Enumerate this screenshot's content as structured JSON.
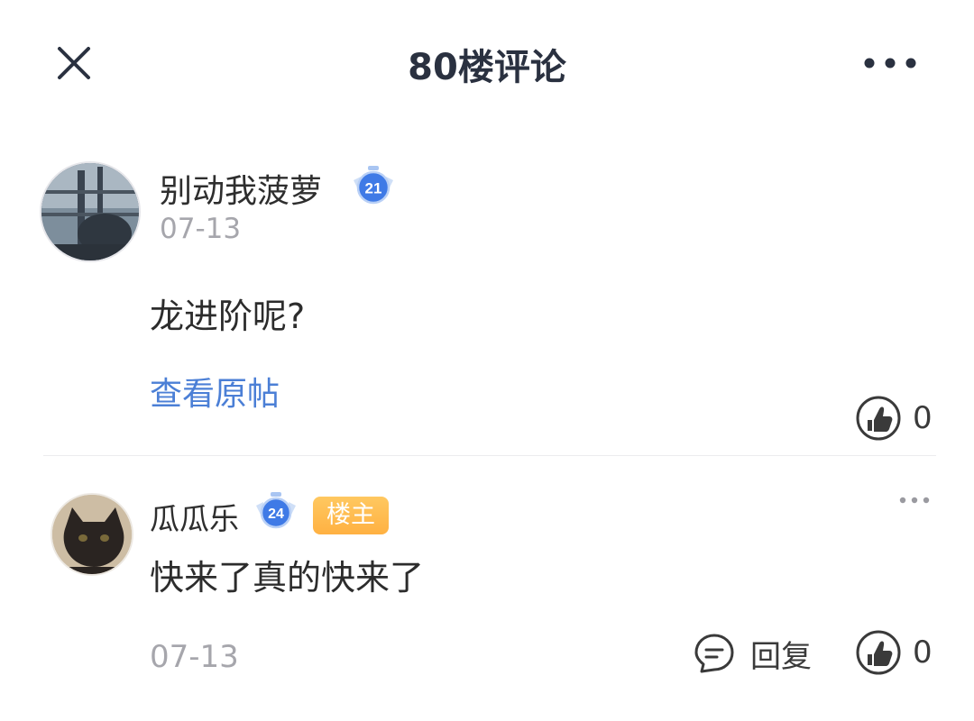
{
  "header": {
    "title": "80楼评论",
    "close_icon": "close-icon",
    "more_icon": "more-horizontal-icon"
  },
  "main_comment": {
    "username": "别动我菠萝",
    "level": "21",
    "timestamp": "07-13",
    "content": "龙进阶呢?",
    "view_original_label": "查看原帖",
    "like_count": "0"
  },
  "replies": [
    {
      "username": "瓜瓜乐",
      "level": "24",
      "op_badge": "楼主",
      "content": "快来了真的快来了",
      "timestamp": "07-13",
      "reply_label": "回复",
      "like_count": "0"
    }
  ],
  "colors": {
    "title": "#2a3140",
    "link": "#4b7fd6",
    "op_badge": "#ffb142",
    "level_badge": "#3f7ae6",
    "muted": "#a6a6ac"
  }
}
